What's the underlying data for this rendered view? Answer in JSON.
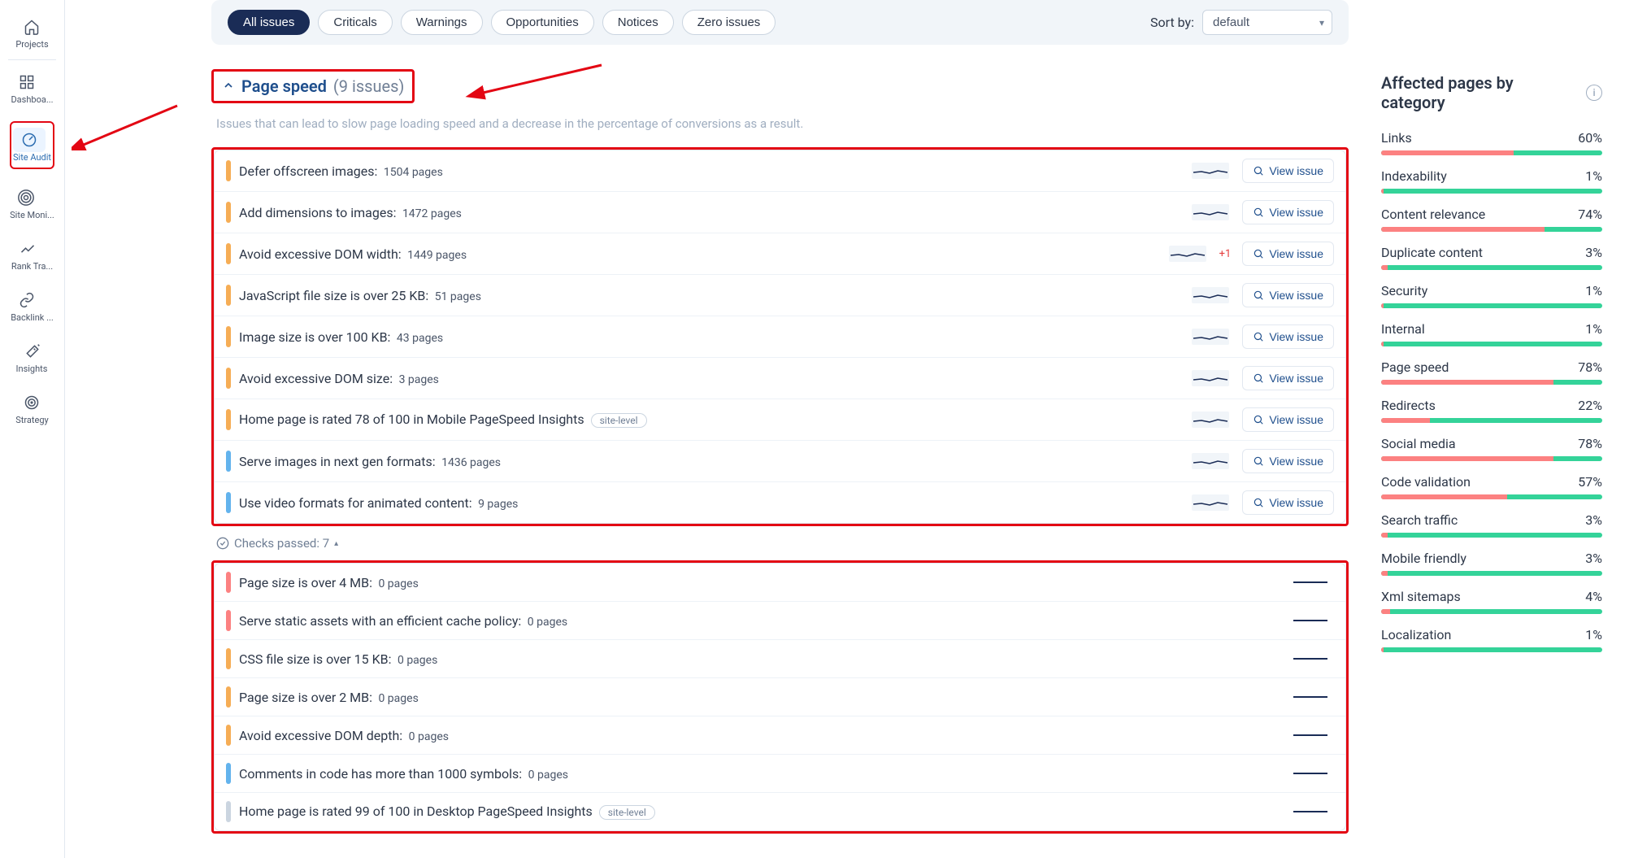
{
  "sidebar": {
    "items": [
      {
        "label": "Projects",
        "icon": "home"
      },
      {
        "label": "Dashboa...",
        "icon": "dashboard"
      },
      {
        "label": "Site Audit",
        "icon": "gauge",
        "active": true
      },
      {
        "label": "Site Moni...",
        "icon": "radar"
      },
      {
        "label": "Rank Tra...",
        "icon": "trend"
      },
      {
        "label": "Backlink ...",
        "icon": "link"
      },
      {
        "label": "Insights",
        "icon": "wand"
      },
      {
        "label": "Strategy",
        "icon": "target"
      }
    ]
  },
  "filters": {
    "pills": [
      "All issues",
      "Criticals",
      "Warnings",
      "Opportunities",
      "Notices",
      "Zero issues"
    ],
    "sort_label": "Sort by:",
    "sort_value": "default"
  },
  "section": {
    "title": "Page speed",
    "count_label": "(9 issues)",
    "description": "Issues that can lead to slow page loading speed and a decrease in the percentage of conversions as a result."
  },
  "issues_active": [
    {
      "sev": "orange",
      "title": "Defer offscreen images:",
      "count": "1504 pages",
      "view": true
    },
    {
      "sev": "orange",
      "title": "Add dimensions to images:",
      "count": "1472 pages",
      "view": true
    },
    {
      "sev": "orange",
      "title": "Avoid excessive DOM width:",
      "count": "1449 pages",
      "view": true,
      "delta": "+1"
    },
    {
      "sev": "orange",
      "title": "JavaScript file size is over 25 KB:",
      "count": "51 pages",
      "view": true
    },
    {
      "sev": "orange",
      "title": "Image size is over 100 KB:",
      "count": "43 pages",
      "view": true
    },
    {
      "sev": "orange",
      "title": "Avoid excessive DOM size:",
      "count": "3 pages",
      "view": true
    },
    {
      "sev": "orange",
      "title": "Home page is rated 78 of 100 in Mobile PageSpeed Insights",
      "site_level": true,
      "view": true
    },
    {
      "sev": "blue",
      "title": "Serve images in next gen formats:",
      "count": "1436 pages",
      "view": true
    },
    {
      "sev": "blue",
      "title": "Use video formats for animated content:",
      "count": "9 pages",
      "view": true
    }
  ],
  "checks_passed_label": "Checks passed: 7",
  "issues_passed": [
    {
      "sev": "red",
      "title": "Page size is over 4 MB:",
      "count": "0 pages"
    },
    {
      "sev": "red",
      "title": "Serve static assets with an efficient cache policy:",
      "count": "0 pages"
    },
    {
      "sev": "orange",
      "title": "CSS file size is over 15 KB:",
      "count": "0 pages"
    },
    {
      "sev": "orange",
      "title": "Page size is over 2 MB:",
      "count": "0 pages"
    },
    {
      "sev": "orange",
      "title": "Avoid excessive DOM depth:",
      "count": "0 pages"
    },
    {
      "sev": "blue",
      "title": "Comments in code has more than 1000 symbols:",
      "count": "0 pages"
    },
    {
      "sev": "gray",
      "title": "Home page is rated 99 of 100 in Desktop PageSpeed Insights",
      "site_level": true
    }
  ],
  "view_issue_label": "View issue",
  "site_level_label": "site-level",
  "right": {
    "title": "Affected pages by category",
    "categories": [
      {
        "name": "Links",
        "pct": "60%",
        "fill": 60
      },
      {
        "name": "Indexability",
        "pct": "1%",
        "fill": 1
      },
      {
        "name": "Content relevance",
        "pct": "74%",
        "fill": 74
      },
      {
        "name": "Duplicate content",
        "pct": "3%",
        "fill": 3
      },
      {
        "name": "Security",
        "pct": "1%",
        "fill": 1
      },
      {
        "name": "Internal",
        "pct": "1%",
        "fill": 1
      },
      {
        "name": "Page speed",
        "pct": "78%",
        "fill": 78
      },
      {
        "name": "Redirects",
        "pct": "22%",
        "fill": 22
      },
      {
        "name": "Social media",
        "pct": "78%",
        "fill": 78
      },
      {
        "name": "Code validation",
        "pct": "57%",
        "fill": 57
      },
      {
        "name": "Search traffic",
        "pct": "3%",
        "fill": 3
      },
      {
        "name": "Mobile friendly",
        "pct": "3%",
        "fill": 3
      },
      {
        "name": "Xml sitemaps",
        "pct": "4%",
        "fill": 4
      },
      {
        "name": "Localization",
        "pct": "1%",
        "fill": 1
      }
    ]
  }
}
